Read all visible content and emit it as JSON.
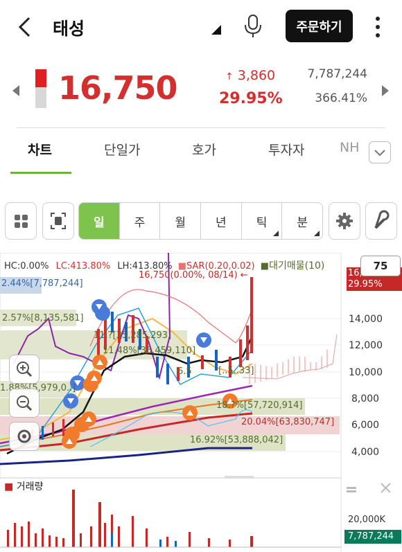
{
  "header": {
    "title": "태성",
    "order_button": "주문하기"
  },
  "quote": {
    "price": "16,750",
    "change": "3,860",
    "change_pct": "29.95%",
    "volume": "7,787,244",
    "volume_pct": "366.41%",
    "up_color": "#d32f2f"
  },
  "tabs": [
    {
      "label": "차트",
      "active": true
    },
    {
      "label": "단일가"
    },
    {
      "label": "호가"
    },
    {
      "label": "투자자"
    },
    {
      "label": "NH"
    }
  ],
  "periods": [
    {
      "label": "일",
      "active": true
    },
    {
      "label": "주"
    },
    {
      "label": "월"
    },
    {
      "label": "년"
    },
    {
      "label": "틱"
    },
    {
      "label": "분"
    }
  ],
  "chart": {
    "info_hc": "HC:0.00%",
    "info_lc": "LC:413.80%",
    "info_lh": "LH:413.80%",
    "info_sar": "SAR(0.20,0.02)",
    "info_vp": "대기매물(10)",
    "last_label": "16,750(0.00%, 08/14)",
    "zoom_box": "75",
    "price_tag": "16,750",
    "pct_tag": "29.95%",
    "y_ticks": [
      "14,000",
      "12,000",
      "10,000",
      "8,000",
      "6,000",
      "4,000"
    ],
    "vp_labels": [
      "2.44%[7,787,244]",
      "2.57%[8,135,581]",
      "1.88%[5,979,0..]",
      "11.?[35,285,293]",
      "11.48%[36,459,110]",
      "18.?%[57,720,914]",
      "20.04%[63,830,747]",
      "16.92%[53,888,042]",
      "[..5..33]",
      "6.5"
    ],
    "volume_label": "거래량",
    "vol_tick": "20,000K",
    "vol_tag": "7,787,244"
  }
}
